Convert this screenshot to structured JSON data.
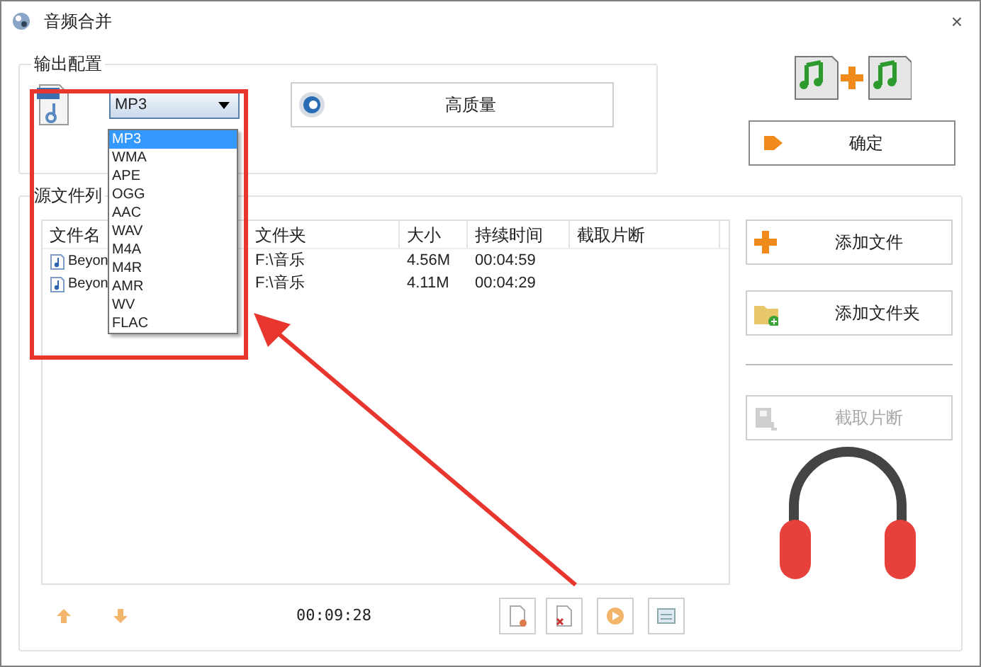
{
  "window": {
    "title": "音频合并",
    "close": "×"
  },
  "output_config": {
    "title": "输出配置",
    "format": {
      "value": "MP3",
      "options": [
        {
          "label": "MP3",
          "selected": true
        },
        {
          "label": "WMA",
          "selected": false
        },
        {
          "label": "APE",
          "selected": false
        },
        {
          "label": "OGG",
          "selected": false
        },
        {
          "label": "AAC",
          "selected": false
        },
        {
          "label": "WAV",
          "selected": false
        },
        {
          "label": "M4A",
          "selected": false
        },
        {
          "label": "M4R",
          "selected": false
        },
        {
          "label": "AMR",
          "selected": false
        },
        {
          "label": "WV",
          "selected": false
        },
        {
          "label": "FLAC",
          "selected": false
        }
      ]
    },
    "quality_button": "高质量"
  },
  "confirm_button": "确定",
  "source_list": {
    "title": "源文件列",
    "columns": [
      "文件名",
      "文件夹",
      "大小",
      "持续时间",
      "截取片断"
    ],
    "rows": [
      {
        "cells": [
          "Beyon",
          "F:\\音乐",
          "4.56M",
          "00:04:59",
          ""
        ]
      },
      {
        "cells": [
          "Beyon",
          "F:\\音乐",
          "4.11M",
          "00:04:29",
          ""
        ]
      }
    ],
    "total_duration": "00:09:28"
  },
  "side_buttons": [
    {
      "label": "添加文件",
      "kind": "add-file",
      "disabled": false
    },
    {
      "label": "添加文件夹",
      "kind": "add-folder",
      "disabled": false
    },
    {
      "label": "截取片断",
      "kind": "clip",
      "disabled": true
    }
  ]
}
